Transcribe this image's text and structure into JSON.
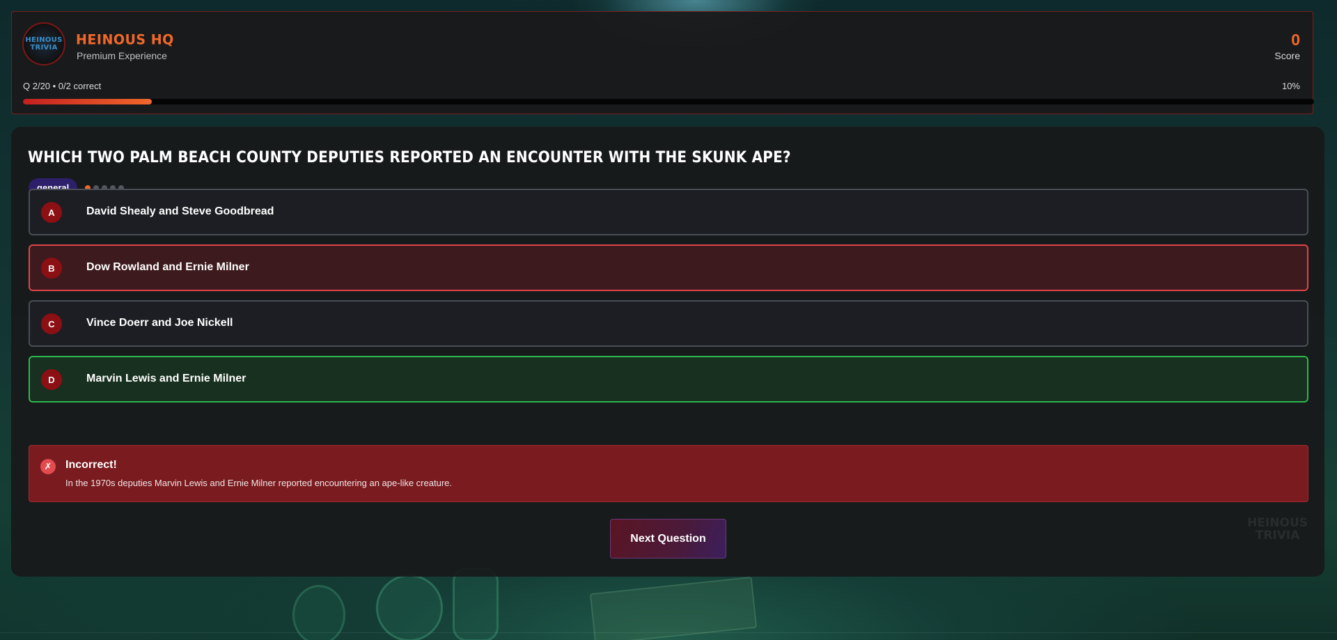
{
  "header": {
    "logo_line1": "HEINOUS",
    "logo_line2": "TRIVIA",
    "title": "HEINOUS HQ",
    "subtitle": "Premium Experience",
    "score_value": "0",
    "score_label": "Score",
    "progress_text": "Q 2/20 • 0/2 correct",
    "progress_percent_label": "10%",
    "progress_fraction": 0.1
  },
  "question": {
    "text": "Which two Palm Beach County deputies reported an encounter with the Skunk Ape?",
    "category": "general",
    "difficulty_level": 1,
    "difficulty_max": 5
  },
  "answers": [
    {
      "letter": "A",
      "text": "David Shealy and Steve Goodbread",
      "state": "neutral"
    },
    {
      "letter": "B",
      "text": "Dow Rowland and Ernie Milner",
      "state": "selected-wrong"
    },
    {
      "letter": "C",
      "text": "Vince Doerr and Joe Nickell",
      "state": "neutral"
    },
    {
      "letter": "D",
      "text": "Marvin Lewis and Ernie Milner",
      "state": "correct"
    }
  ],
  "feedback": {
    "icon": "✗",
    "title": "Incorrect!",
    "text": "In the 1970s deputies Marvin Lewis and Ernie Milner reported encountering an ape-like creature."
  },
  "next_button_label": "Next Question",
  "watermark": {
    "line1": "HEINOUS",
    "line2": "TRIVIA"
  },
  "colors": {
    "accent": "#f2682a",
    "wrong": "#e0454a",
    "correct": "#2fb64f",
    "category_badge": "#2e1f6a"
  }
}
